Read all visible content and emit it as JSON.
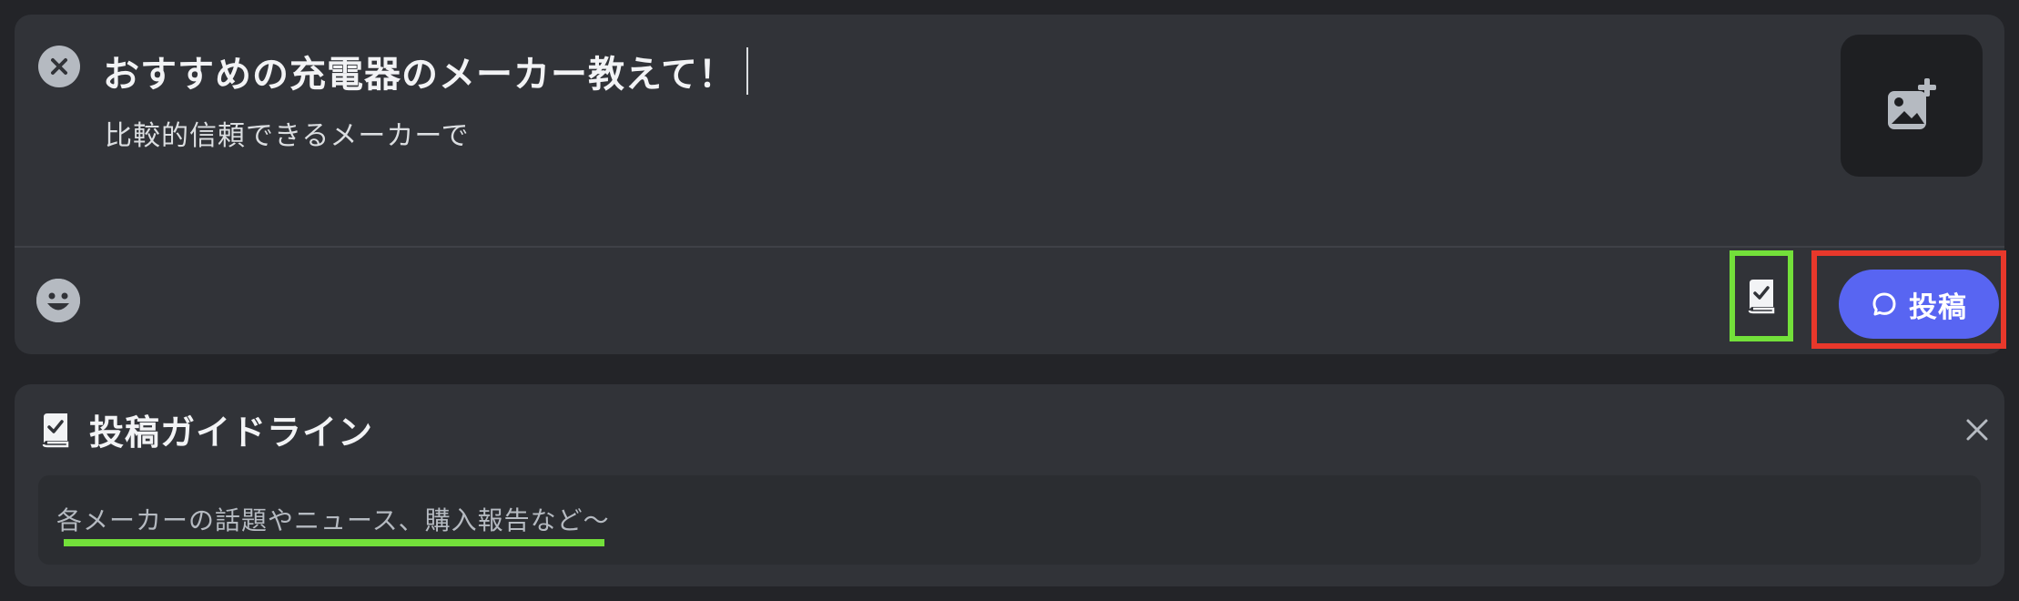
{
  "compose": {
    "title": "おすすめの充電器のメーカー教えて！",
    "body": "比較的信頼できるメーカーで",
    "post_label": "投稿"
  },
  "guidelines": {
    "title": "投稿ガイドライン",
    "text": "各メーカーの話題やニュース、購入報告など〜"
  },
  "colors": {
    "accent": "#5865f2",
    "highlight_green": "#73e03a",
    "highlight_red": "#e8382b",
    "card_bg": "#313338",
    "page_bg": "#232428"
  },
  "icons": {
    "close": "close-circle-icon",
    "add_image": "image-plus-icon",
    "emoji": "emoji-icon",
    "guide": "guide-book-icon",
    "post": "chat-bubble-icon",
    "guide_close": "close-icon"
  }
}
